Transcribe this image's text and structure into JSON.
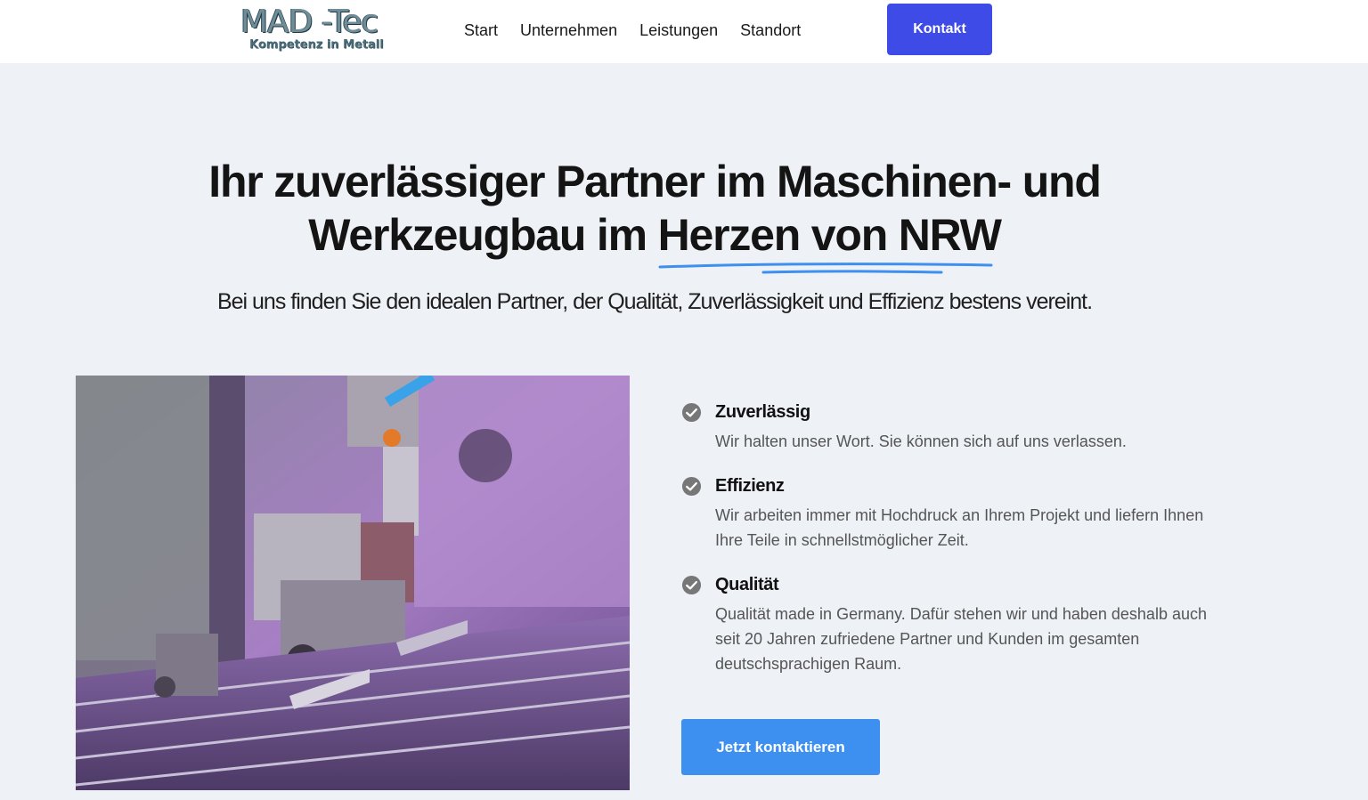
{
  "header": {
    "logo_main": "MAD -Tec",
    "logo_sub": "Kompetenz in Metall",
    "nav": [
      "Start",
      "Unternehmen",
      "Leistungen",
      "Standort"
    ],
    "kontakt_label": "Kontakt"
  },
  "hero": {
    "headline_line1": "Ihr zuverlässiger Partner im Maschinen- und",
    "headline_line2_pre": "Werkzeugbau im ",
    "headline_highlight": "Herzen von NRW",
    "subline": "Bei uns finden Sie den idealen Partner, der Qualität, Zuverlässigkeit und Effizienz bestens vereint."
  },
  "features": [
    {
      "title": "Zuverlässig",
      "desc": "Wir halten unser Wort. Sie können sich auf uns verlassen.",
      "icon": "check-circle-icon"
    },
    {
      "title": "Effizienz",
      "desc": "Wir arbeiten immer mit Hochdruck an Ihrem Projekt und liefern Ihnen Ihre Teile in schnellstmöglicher Zeit.",
      "icon": "check-circle-icon"
    },
    {
      "title": "Qualität",
      "desc": "Qualität made in Germany. Dafür stehen wir und haben deshalb auch seit 20 Jahren zufriedene Partner und Kunden im gesamten deutschsprachigen Raum.",
      "icon": "check-circle-icon"
    }
  ],
  "cta_label": "Jetzt kontaktieren",
  "colors": {
    "kontakt_button": "#3f4be6",
    "cta_button": "#3d8ff0",
    "background": "#eef1f5",
    "underline": "#3d8ff0"
  }
}
